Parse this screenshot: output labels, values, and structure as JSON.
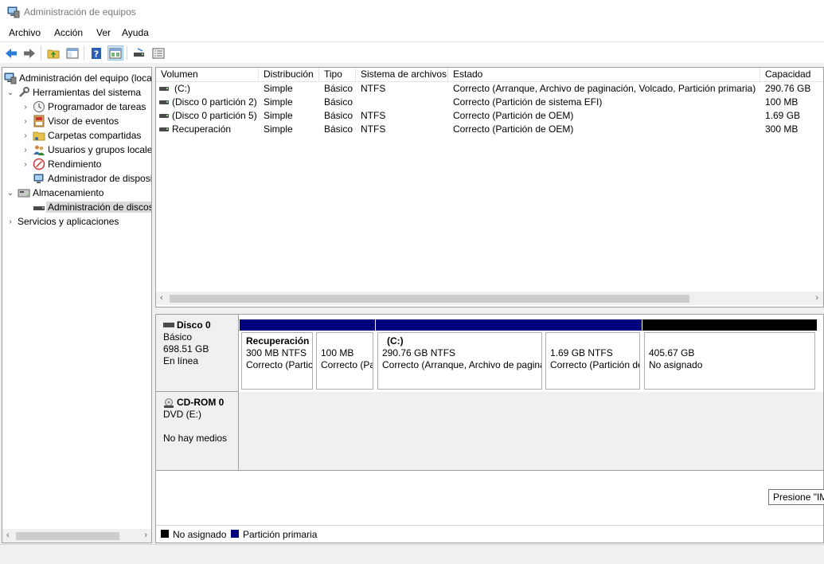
{
  "window": {
    "title": "Administración de equipos"
  },
  "menu": [
    "Archivo",
    "Acción",
    "Ver",
    "Ayuda"
  ],
  "toolbar": [
    "back-icon",
    "forward-icon",
    "up-folder-icon",
    "show-hide-tree-icon",
    "help-icon",
    "properties-icon",
    "rescan-icon",
    "list-icon"
  ],
  "tree": {
    "root": "Administración del equipo (local)",
    "items": [
      {
        "label": "Herramientas del sistema",
        "icon": "tools-icon"
      },
      {
        "label": "Programador de tareas",
        "icon": "clock-icon"
      },
      {
        "label": "Visor de eventos",
        "icon": "event-viewer-icon"
      },
      {
        "label": "Carpetas compartidas",
        "icon": "shared-folder-icon"
      },
      {
        "label": "Usuarios y grupos locales",
        "icon": "users-icon"
      },
      {
        "label": "Rendimiento",
        "icon": "performance-icon"
      },
      {
        "label": "Administrador de dispositivos",
        "icon": "device-manager-icon"
      },
      {
        "label": "Almacenamiento",
        "icon": "storage-icon"
      },
      {
        "label": "Administración de discos",
        "icon": "disk-icon"
      },
      {
        "label": "Servicios y aplicaciones",
        "icon": "services-icon"
      }
    ]
  },
  "volumes": {
    "columns": [
      "Volumen",
      "Distribución",
      "Tipo",
      "Sistema de archivos",
      "Estado",
      "Capacidad"
    ],
    "rows": [
      [
        "(C:)",
        "Simple",
        "Básico",
        "NTFS",
        "Correcto (Arranque, Archivo de paginación, Volcado, Partición primaria)",
        "290.76 GB"
      ],
      [
        "(Disco 0 partición 2)",
        "Simple",
        "Básico",
        "",
        "Correcto (Partición de sistema EFI)",
        "100 MB"
      ],
      [
        "(Disco 0 partición 5)",
        "Simple",
        "Básico",
        "NTFS",
        "Correcto (Partición de OEM)",
        "1.69 GB"
      ],
      [
        "Recuperación",
        "Simple",
        "Básico",
        "NTFS",
        "Correcto (Partición de OEM)",
        "300 MB"
      ]
    ]
  },
  "disk0": {
    "name": "Disco 0",
    "type": "Básico",
    "size": "698.51 GB",
    "status": "En línea",
    "partitions": [
      {
        "name": "Recuperación",
        "size": "300 MB NTFS",
        "status": "Correcto (Partición de OEM)"
      },
      {
        "name": "",
        "size": "100 MB",
        "status": "Correcto (Partición de sistema EFI)"
      },
      {
        "name": "(C:)",
        "size": "290.76 GB NTFS",
        "status": "Correcto (Arranque, Archivo de paginación, Volcado, Partición primaria)"
      },
      {
        "name": "",
        "size": "1.69 GB NTFS",
        "status": "Correcto (Partición de OEM)"
      },
      {
        "name": "",
        "size": "405.67 GB",
        "status": "No asignado"
      }
    ]
  },
  "cdrom0": {
    "name": "CD-ROM 0",
    "drive": "DVD (E:)",
    "status": "No hay medios"
  },
  "legend": [
    {
      "label": "No asignado",
      "color": "#000000"
    },
    {
      "label": "Partición primaria",
      "color": "#00007f"
    }
  ],
  "tooltip": "Presione \"IMPR PANT\""
}
